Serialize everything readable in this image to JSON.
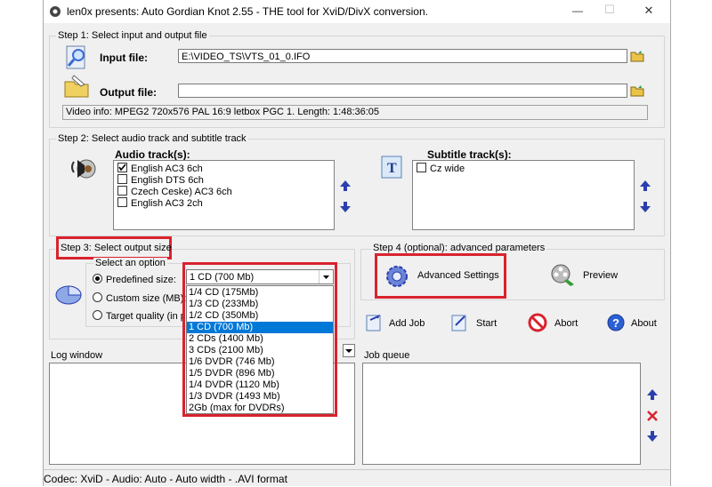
{
  "window": {
    "title": "len0x presents: Auto Gordian Knot 2.55 - THE tool for XviD/DivX conversion.",
    "minimize_label": "—",
    "maximize_label": "☐",
    "close_label": "✕"
  },
  "step1": {
    "title": "Step 1: Select input and output file",
    "input_label": "Input file:",
    "input_value": "E:\\VIDEO_TS\\VTS_01_0.IFO",
    "output_label": "Output file:",
    "output_value": "",
    "video_info": "Video info: MPEG2 720x576 PAL 16:9 letbox  PGC 1. Length: 1:48:36:05"
  },
  "step2": {
    "title": "Step 2: Select audio track and subtitle track",
    "audio_label": "Audio track(s):",
    "audio_tracks": [
      {
        "label": "English AC3 6ch",
        "checked": true
      },
      {
        "label": "English DTS 6ch",
        "checked": false
      },
      {
        "label": "Czech Ceske) AC3 6ch",
        "checked": false
      },
      {
        "label": "English AC3 2ch",
        "checked": false
      }
    ],
    "subtitle_label": "Subtitle track(s):",
    "subtitle_tracks": [
      {
        "label": "Cz wide",
        "checked": false
      }
    ]
  },
  "step3": {
    "title": "Step 3: Select output size",
    "subtitle": "Select an option",
    "options": [
      "Predefined size:",
      "Custom size (MB):",
      "Target quality (in p"
    ],
    "selected_option": 0,
    "dropdown_value": "1 CD (700 Mb)",
    "dropdown_options": [
      "1/4 CD (175Mb)",
      "1/3 CD (233Mb)",
      "1/2 CD (350Mb)",
      "1 CD (700 Mb)",
      "2 CDs (1400 Mb)",
      "3 CDs (2100 Mb)",
      "1/6 DVDR (746 Mb)",
      "1/5 DVDR (896 Mb)",
      "1/4 DVDR (1120 Mb)",
      "1/3 DVDR (1493 Mb)",
      "2Gb (max for DVDRs)"
    ],
    "dropdown_selected_index": 3
  },
  "step4": {
    "title": "Step 4 (optional): advanced parameters",
    "advanced_label": "Advanced Settings",
    "preview_label": "Preview"
  },
  "actions": {
    "add_job": "Add Job",
    "start": "Start",
    "abort": "Abort",
    "about": "About"
  },
  "log": {
    "title": "Log window"
  },
  "queue": {
    "title": "Job queue"
  },
  "status": "Codec: XviD -  Audio: Auto -  Auto width - .AVI format",
  "colors": {
    "highlight": "#d9232e",
    "selection": "#0078d7",
    "arrow_blue": "#2a3fae"
  }
}
